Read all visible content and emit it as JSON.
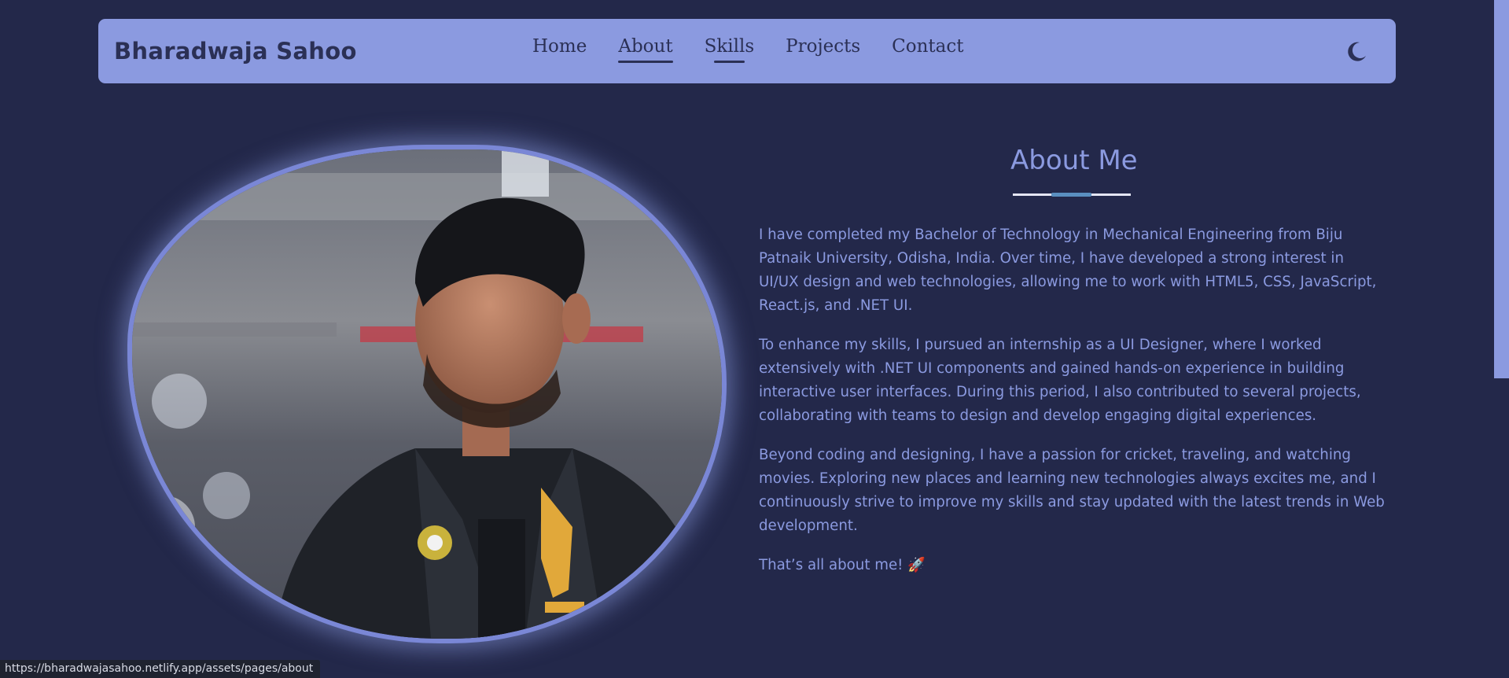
{
  "header": {
    "brand": "Bharadwaja Sahoo",
    "nav": [
      {
        "label": "Home"
      },
      {
        "label": "About"
      },
      {
        "label": "Skills"
      },
      {
        "label": "Projects"
      },
      {
        "label": "Contact"
      }
    ],
    "theme_toggle_icon": "moon-icon"
  },
  "about": {
    "title": "About Me",
    "paragraphs": [
      "I have completed my Bachelor of Technology in Mechanical Engineering from Biju Patnaik University, Odisha, India. Over time, I have developed a strong interest in UI/UX design and web technologies, allowing me to work with HTML5, CSS, JavaScript, React.js, and .NET UI.",
      "To enhance my skills, I pursued an internship as a UI Designer, where I worked extensively with .NET UI components and gained hands-on experience in building interactive user interfaces. During this period, I also contributed to several projects, collaborating with teams to design and develop engaging digital experiences.",
      "Beyond coding and designing, I have a passion for cricket, traveling, and watching movies. Exploring new places and learning new technologies always excites me, and I continuously strive to improve my skills and stay updated with the latest trends in Web development.",
      "That’s all about me! 🚀"
    ]
  },
  "status_bar": {
    "url": "https://bharadwajasahoo.netlify.app/assets/pages/about"
  },
  "colors": {
    "background": "#23284a",
    "accent": "#8b9ae0",
    "dark_text": "#2b3055",
    "underline_accent": "#5a8fc0"
  }
}
